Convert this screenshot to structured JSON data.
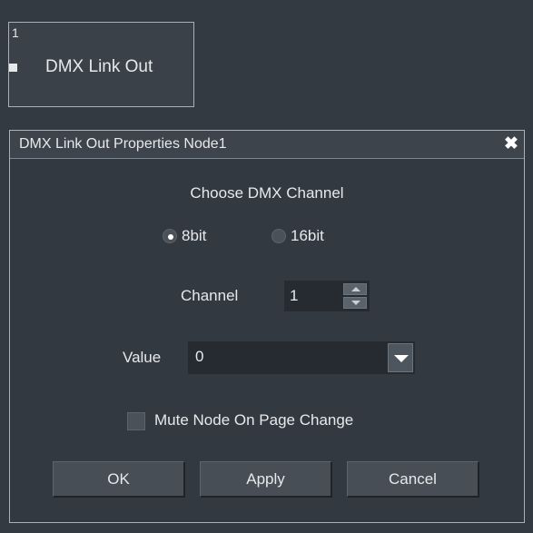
{
  "canvas_node": {
    "index": "1",
    "label": "DMX Link Out"
  },
  "dialog": {
    "title": "DMX Link Out Properties Node1",
    "close_glyph": "✖",
    "heading": "Choose DMX Channel",
    "radio_options": [
      {
        "label": "8bit",
        "selected": true
      },
      {
        "label": "16bit",
        "selected": false
      }
    ],
    "channel": {
      "label": "Channel",
      "value": "1"
    },
    "value": {
      "label": "Value",
      "selected": "0"
    },
    "mute_checkbox": {
      "label": "Mute Node On Page Change",
      "checked": false
    },
    "buttons": {
      "ok": "OK",
      "apply": "Apply",
      "cancel": "Cancel"
    }
  }
}
